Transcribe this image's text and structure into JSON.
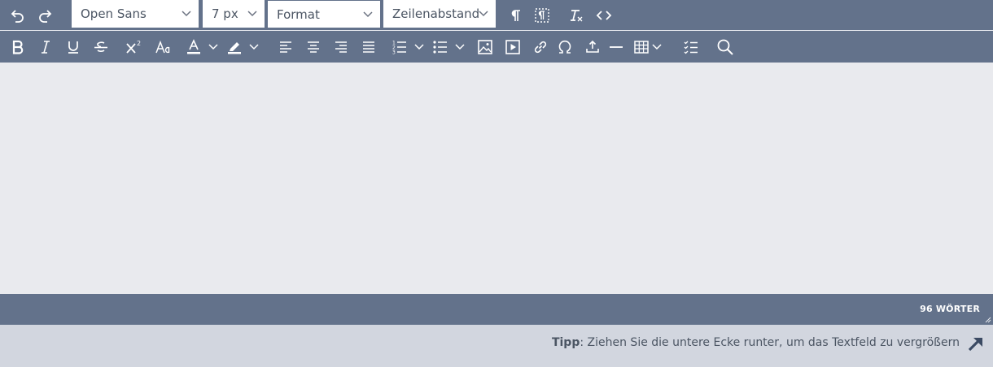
{
  "toolbar": {
    "font_family": "Open Sans",
    "font_size": "7 px",
    "format": "Format",
    "line_height": "Zeilenabstand"
  },
  "statusbar": {
    "word_count": "96 WÖRTER"
  },
  "tip": {
    "label": "Tipp",
    "text": ": Ziehen Sie die untere Ecke runter, um das Textfeld zu vergrößern"
  },
  "colors": {
    "toolbar_bg": "#63728b",
    "content_bg": "#e9eaee",
    "tip_bg": "#d2d6df",
    "icon": "#ffffff"
  },
  "icons": [
    "undo-icon",
    "redo-icon",
    "paragraph-icon",
    "show-blocks-icon",
    "clear-format-icon",
    "code-icon",
    "bold-icon",
    "italic-icon",
    "underline-icon",
    "strikethrough-icon",
    "superscript-icon",
    "font-case-icon",
    "text-color-icon",
    "highlight-icon",
    "align-left-icon",
    "align-center-icon",
    "align-right-icon",
    "align-justify-icon",
    "ordered-list-icon",
    "unordered-list-icon",
    "image-icon",
    "video-icon",
    "link-icon",
    "omega-icon",
    "upload-icon",
    "horizontal-line-icon",
    "table-icon",
    "checklist-icon",
    "search-icon",
    "resize-handle-icon",
    "arrow-up-right-icon"
  ]
}
